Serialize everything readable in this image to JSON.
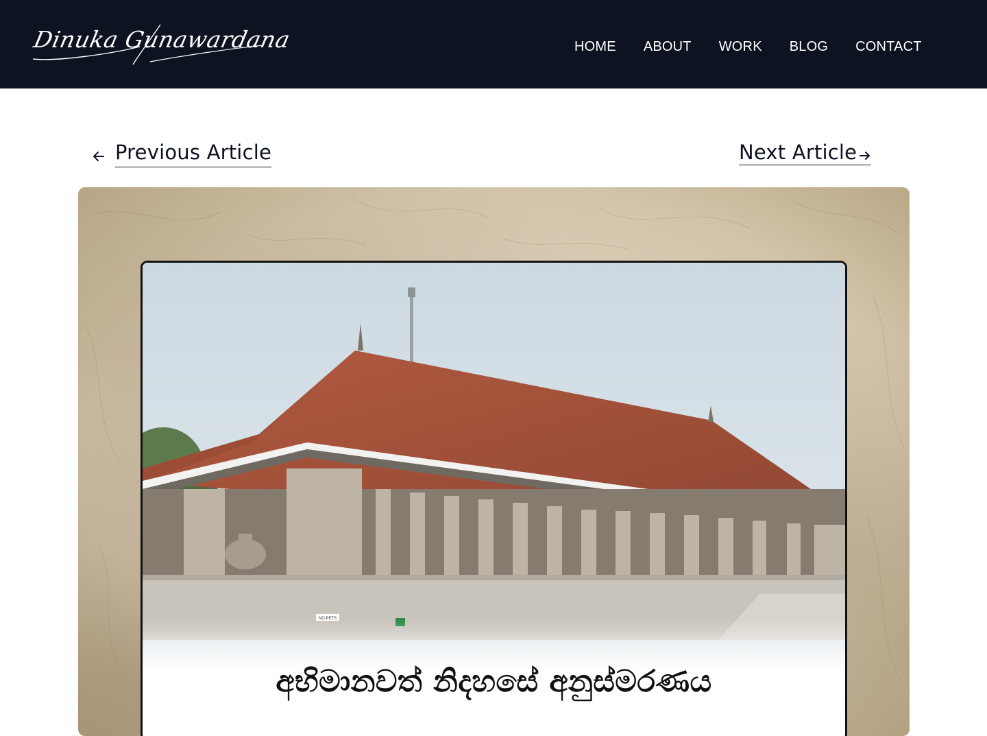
{
  "site": {
    "logo_text": "Dinuka Gunawardana"
  },
  "nav": {
    "items": [
      {
        "label": "HOME"
      },
      {
        "label": "ABOUT"
      },
      {
        "label": "WORK"
      },
      {
        "label": "BLOG"
      },
      {
        "label": "CONTACT"
      }
    ]
  },
  "article_nav": {
    "previous_label": "Previous Article",
    "next_label": "Next Article"
  },
  "article": {
    "title": "අභිමානවත් නිදහසේ අනුස්මරණය",
    "sign_text": "NO PETS"
  },
  "colors": {
    "navbar_bg": "#0d1321",
    "nav_text": "#ffffff",
    "body_text": "#0d1220",
    "paper": "#d9ccb3",
    "roof": "#a5503a"
  },
  "icons": {
    "previous": "arrow-left-icon",
    "next": "arrow-right-icon"
  }
}
